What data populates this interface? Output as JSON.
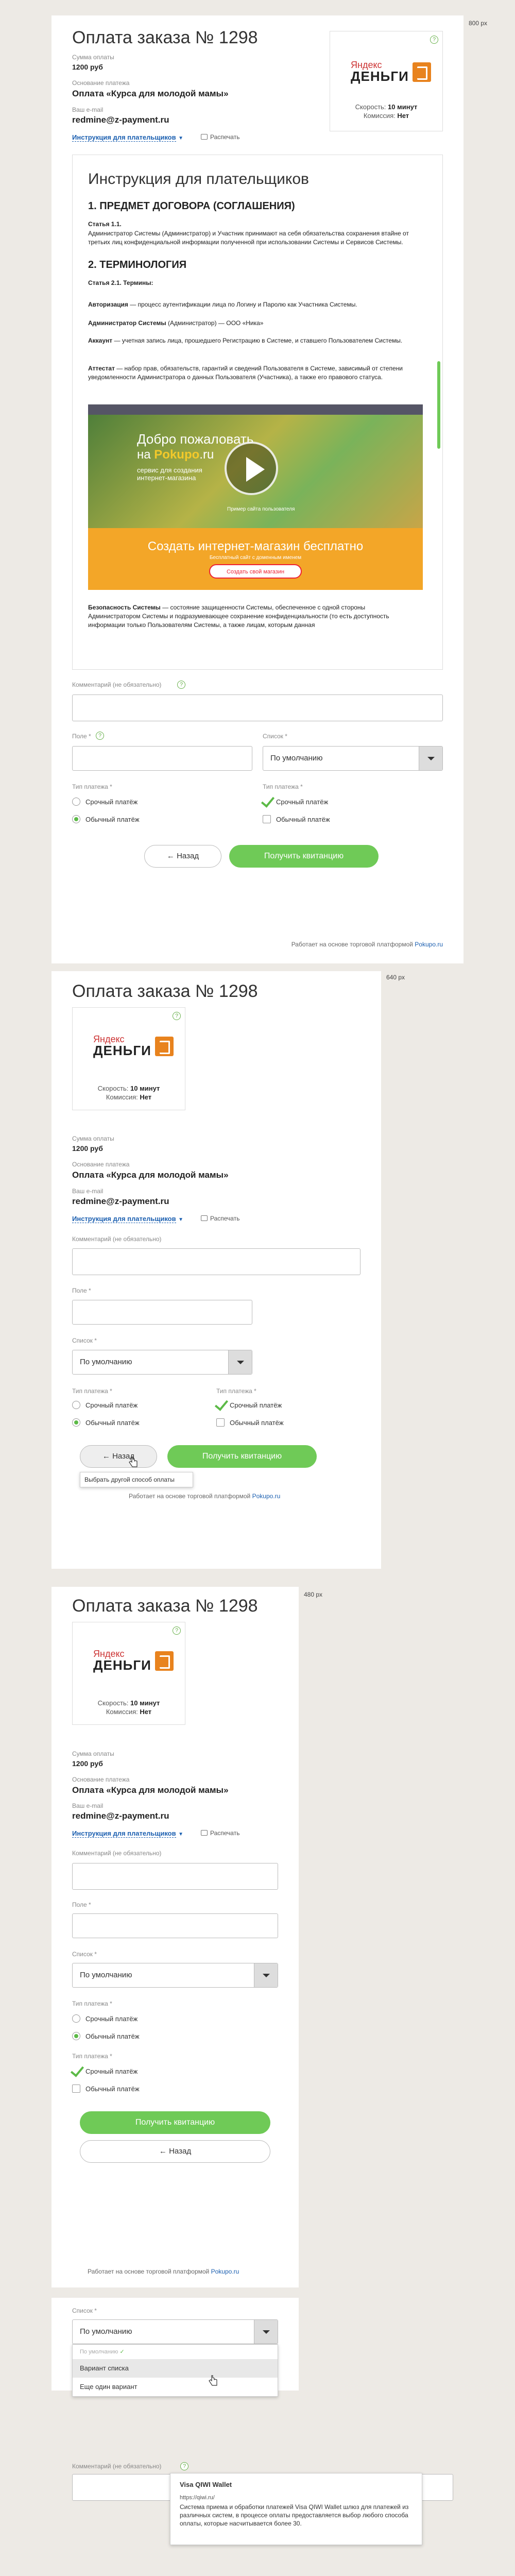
{
  "labels": {
    "w800": "800 px",
    "w640": "640 px",
    "w480": "480 px"
  },
  "order": {
    "title": "Оплата заказа № 1298",
    "sum_label": "Сумма оплаты",
    "sum_value": "1200 руб",
    "basis_label": "Основание платежа",
    "basis_value": "Оплата «Курса для молодой мамы»",
    "email_label": "Ваш e-mail",
    "email_value": "redmine@z-payment.ru",
    "instructions_link": "Инструкция для плательщиков",
    "print_label": "Распечать"
  },
  "method": {
    "logo_top": "Яндекс",
    "logo_main": "ДЕНЬГИ",
    "speed_label": "Скорость:",
    "speed_value": "10 минут",
    "fee_label": "Комиссия:",
    "fee_value": "Нет",
    "info": "?"
  },
  "doc": {
    "heading": "Инструкция для плательщиков",
    "s1": "1. ПРЕДМЕТ ДОГОВОРА (СОГЛАШЕНИЯ)",
    "art11": "Статья 1.1.",
    "p1": "Администратор Системы (Администратор) и Участник принимают на себя обязательства сохранения втайне от третьих лиц конфиденциальной информации полученной при использовании Системы и Сервисов Системы.",
    "s2": "2. ТЕРМИНОЛОГИЯ",
    "art21": "Статья 2.1. Термины:",
    "t1b": "Авторизация",
    "t1": " — процесс аутентификации лица по Логину и Паролю как Участника Системы.",
    "t2b": "Администратор Системы",
    "t2": " (Администратор) — ООО «Ника»",
    "t3b": "Аккаунт",
    "t3": " — учетная запись лица, прошедшего Регистрацию в Системе, и ставшего Пользователем Системы.",
    "t4b": "Аттестат",
    "t4": " — набор прав, обязательств, гарантий и сведений Пользователя в Системе, зависимый от степени уведомленности Администратора о данных Пользователя (Участника), а также его правового статуса.",
    "t5b": "Безопасность Системы",
    "t5": " — состояние защищенности Системы, обеспеченное с одной стороны Администратором Системы и подразумевающее сохранение конфиденциальности (то есть доступность информации только Пользователям Системы, а также лицам, которым данная"
  },
  "video": {
    "welcome": "Добро пожаловать",
    "to": "на",
    "brand": "Pokupo",
    "brand_tail": ".ru",
    "service": "сервис для создания интернет-магазина",
    "small": "Пример сайта пользователя",
    "banner": "Создать интернет-магазин бесплатно",
    "banner_sub": "Бесплатный сайт с доменным именем",
    "banner_btn": "Создать свой магазин"
  },
  "form": {
    "comment_label": "Комментарий (не обязательно)",
    "field_label": "Поле *",
    "list_label": "Список *",
    "list_value": "По умолчанию",
    "type_label": "Тип платежа *",
    "urgent": "Срочный платёж",
    "normal": "Обычный платёж",
    "back": "← Назад",
    "pay": "Получить квитанцию",
    "footer_prefix": "Работает на основе торговой платформой ",
    "footer_link": "Pokupo.ru",
    "tooltip_back": "Выбрать другой способ оплаты"
  },
  "dropdown": {
    "items": [
      "По умолчанию",
      "Вариант списка",
      "Еще один вариант"
    ]
  },
  "qiwi_tip": {
    "title": "Visa QIWI Wallet",
    "url": "https://qiwi.ru/",
    "text": "Система приема и обработки платежей Visa QIWI Wallet шлюз для платежей из различных систем, в процессе оплаты предоставляется выбор любого способа оплаты, которые насчитывается более 30."
  },
  "colors": {
    "accent": "#6fca57",
    "link": "#1b5fb0",
    "ym_orange": "#e8831e"
  }
}
